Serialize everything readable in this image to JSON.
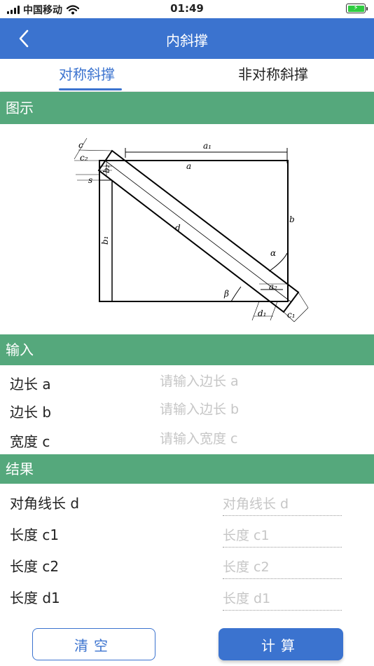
{
  "status_bar": {
    "carrier": "中国移动",
    "time": "01:49"
  },
  "nav": {
    "title": "内斜撑"
  },
  "tabs": [
    {
      "label": "对称斜撑",
      "active": true
    },
    {
      "label": "非对称斜撑",
      "active": false
    }
  ],
  "sections": {
    "diagram": "图示",
    "input": "输入",
    "result": "结果"
  },
  "diagram_labels": {
    "a1": "a₁",
    "a": "a",
    "b": "b",
    "b1": "b₁",
    "b2": "b₂",
    "c": "c",
    "c2": "c₂",
    "s": "s",
    "d": "d",
    "alpha": "α",
    "beta": "β",
    "a2": "a₂",
    "d1": "d₁",
    "c1": "c₁"
  },
  "inputs": [
    {
      "label": "边长 a",
      "placeholder": "请输入边长 a",
      "value": ""
    },
    {
      "label": "边长 b",
      "placeholder": "请输入边长 b",
      "value": ""
    },
    {
      "label": "宽度 c",
      "placeholder": "请输入宽度 c",
      "value": ""
    }
  ],
  "results": [
    {
      "label": "对角线长 d",
      "placeholder": "对角线长 d"
    },
    {
      "label": "长度 c1",
      "placeholder": "长度 c1"
    },
    {
      "label": "长度 c2",
      "placeholder": "长度 c2"
    },
    {
      "label": "长度 d1",
      "placeholder": "长度 d1"
    }
  ],
  "buttons": {
    "clear": "清空",
    "calc": "计算"
  },
  "colors": {
    "primary": "#3b73cf",
    "section": "#55a87c"
  }
}
